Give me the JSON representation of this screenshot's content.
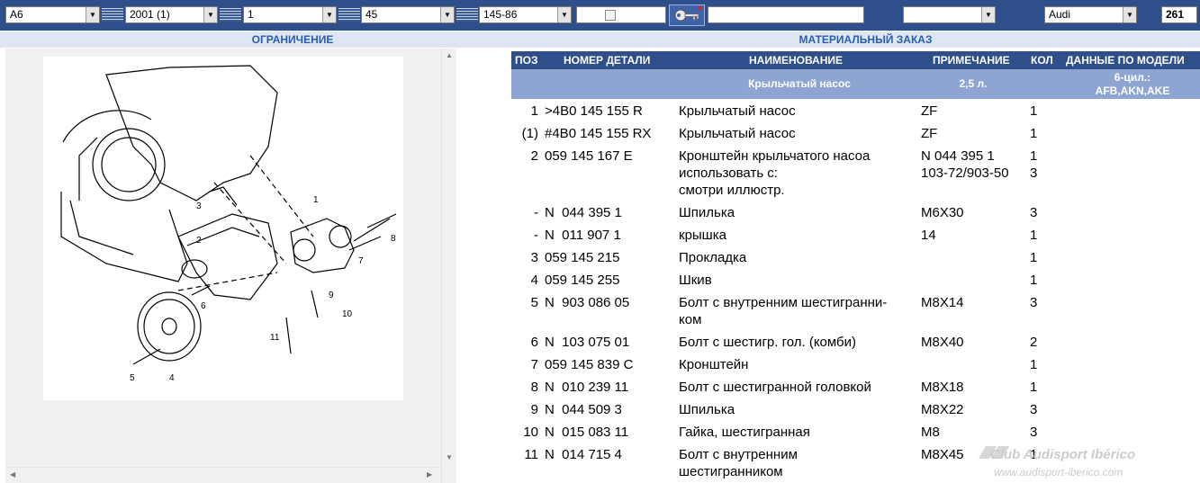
{
  "toolbar": {
    "model": "A6",
    "year": "2001 (1)",
    "group": "1",
    "subgroup": "45",
    "illustration": "145-86",
    "search_value": "",
    "option_value": "",
    "brand": "Audi",
    "count": "261"
  },
  "panels": {
    "left_title": "ОГРАНИЧЕНИЕ",
    "right_title": "МАТЕРИАЛЬНЫЙ ЗАКАЗ"
  },
  "callouts": [
    "1",
    "2",
    "3",
    "4",
    "5",
    "6",
    "7",
    "8",
    "9",
    "10",
    "11"
  ],
  "table": {
    "headers": {
      "pos": "ПОЗ",
      "part": "НОМЕР ДЕТАЛИ",
      "name": "НАИМЕНОВАНИЕ",
      "note": "ПРИМЕЧАНИЕ",
      "qty": "КОЛ",
      "model": "ДАННЫЕ ПО МОДЕЛИ"
    },
    "subheader": {
      "name": "Крыльчатый насос",
      "note": "2,5 л.",
      "model_line1": "6-цил.:",
      "model_line2": "AFB,AKN,AKE"
    },
    "rows": [
      {
        "pos": "1",
        "part": ">4B0 145 155 R",
        "name": "Крыльчатый насос",
        "note": "ZF",
        "qty": "1"
      },
      {
        "pos": "(1)",
        "part": "#4B0 145 155 RX",
        "name": "Крыльчатый насос",
        "note": "ZF",
        "qty": "1"
      },
      {
        "pos": "2",
        "part": "059 145 167 E",
        "name": "Кронштейн крыльчатого насоа\nиспользовать с:\nсмотри иллюстр.",
        "note": "N 044 395 1\n103-72/903-50",
        "qty": "1\n3"
      },
      {
        "pos": "-",
        "part": "N  044 395 1",
        "name": "Шпилька",
        "note": "M6X30",
        "qty": "3"
      },
      {
        "pos": "-",
        "part": "N  011 907 1",
        "name": "крышка",
        "note": "14",
        "qty": "1"
      },
      {
        "pos": "3",
        "part": "059 145 215",
        "name": "Прокладка",
        "note": "",
        "qty": "1"
      },
      {
        "pos": "4",
        "part": "059 145 255",
        "name": "Шкив",
        "note": "",
        "qty": "1"
      },
      {
        "pos": "5",
        "part": "N  903 086 05",
        "name": "Болт с внутренним шестигранни-\nком",
        "note": "M8X14",
        "qty": "3"
      },
      {
        "pos": "6",
        "part": "N  103 075 01",
        "name": "Болт с шестигр. гол. (комби)",
        "note": "M8X40",
        "qty": "2"
      },
      {
        "pos": "7",
        "part": "059 145 839 C",
        "name": "Кронштейн",
        "note": "",
        "qty": "1"
      },
      {
        "pos": "8",
        "part": "N  010 239 11",
        "name": "Болт с шестигранной головкой",
        "note": "M8X18",
        "qty": "1"
      },
      {
        "pos": "9",
        "part": "N  044 509 3",
        "name": "Шпилька",
        "note": "M8X22",
        "qty": "3"
      },
      {
        "pos": "10",
        "part": "N  015 083 11",
        "name": "Гайка, шестигранная",
        "note": "M8",
        "qty": "3"
      },
      {
        "pos": "11",
        "part": "N  014 715 4",
        "name": "Болт с внутренним\nшестигранником",
        "note": "M8X45",
        "qty": "1"
      }
    ]
  },
  "watermark": {
    "line1": "Club Audisport Ibérico",
    "line2": "www.audisport-iberico.com"
  },
  "colors": {
    "toolbar_bg": "#2f4f8a",
    "header_text": "#2a5db0",
    "table_header_bg": "#8ea5d2"
  }
}
